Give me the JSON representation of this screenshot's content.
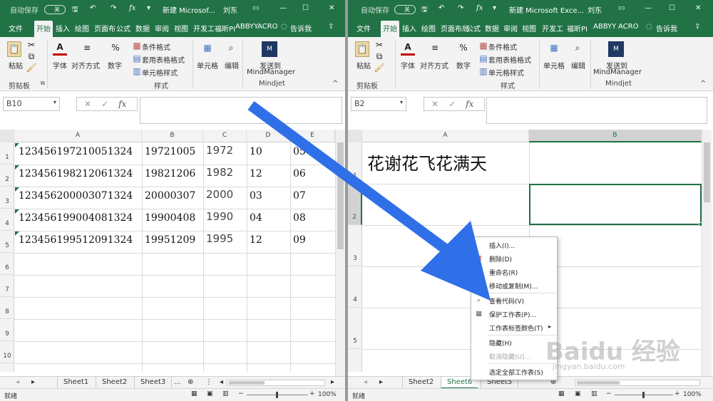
{
  "left": {
    "titlebar": {
      "autosave": "自动保存",
      "toggle": "关",
      "title": "新建 Microsof...",
      "user": "刘东"
    },
    "tabs": [
      "文件",
      "开始",
      "插入",
      "绘图",
      "页面布",
      "公式",
      "数据",
      "审阅",
      "视图",
      "开发工",
      "福昕PI",
      "ABBYY",
      "ACRO"
    ],
    "tell_me": "告诉我",
    "ribbon": {
      "paste": "粘贴",
      "clipboard": "剪贴板",
      "font": "字体",
      "align": "对齐方式",
      "number": "数字",
      "cond_format": "条件格式",
      "table_format": "套用表格格式",
      "cell_style": "单元格样式",
      "styles": "样式",
      "cells": "单元格",
      "edit": "编辑",
      "send_to": "发送到",
      "mindmanager": "MindManager",
      "mindjet": "Mindjet"
    },
    "namebox": "B10",
    "fx": "fx",
    "columns": [
      "A",
      "B",
      "C",
      "D",
      "E"
    ],
    "rows": [
      "1",
      "2",
      "3",
      "4",
      "5",
      "6",
      "7",
      "8",
      "9",
      "10"
    ],
    "data": [
      [
        "123456197210051324",
        "19721005",
        "1972",
        "10",
        "05"
      ],
      [
        "123456198212061324",
        "19821206",
        "1982",
        "12",
        "06"
      ],
      [
        "123456200003071324",
        "20000307",
        "2000",
        "03",
        "07"
      ],
      [
        "123456199004081324",
        "19900408",
        "1990",
        "04",
        "08"
      ],
      [
        "123456199512091324",
        "19951209",
        "1995",
        "12",
        "09"
      ]
    ],
    "sheets": [
      "Sheet1",
      "Sheet2",
      "Sheet3"
    ],
    "more": "...",
    "status": "就绪",
    "zoom": "100%"
  },
  "right": {
    "titlebar": {
      "autosave": "自动保存",
      "toggle": "关",
      "title": "新建 Microsoft Exce...",
      "user": "刘东"
    },
    "tabs": [
      "文件",
      "开始",
      "插入",
      "绘图",
      "页面布局",
      "公式",
      "数据",
      "审阅",
      "视图",
      "开发工",
      "福昕PI",
      "ABBYY",
      "ACRO"
    ],
    "tell_me": "告诉我",
    "ribbon": {
      "paste": "粘贴",
      "clipboard": "剪贴板",
      "font": "字体",
      "align": "对齐方式",
      "number": "数字",
      "cond_format": "条件格式",
      "table_format": "套用表格格式",
      "cell_style": "单元格样式",
      "styles": "样式",
      "cells": "单元格",
      "edit": "编辑",
      "send_to": "发送到",
      "mindmanager": "MindManager",
      "mindjet": "Mindjet"
    },
    "namebox": "B2",
    "fx": "fx",
    "columns": [
      "A",
      "B"
    ],
    "rows": [
      "1",
      "2",
      "3",
      "4",
      "5"
    ],
    "a1": "花谢花飞花满天",
    "sheets": [
      "Sheet2",
      "Sheet6",
      "Sheet5"
    ],
    "status": "就绪",
    "zoom": "100%"
  },
  "context_menu": [
    {
      "label": "插入(I)...",
      "enabled": true
    },
    {
      "label": "删除(D)",
      "enabled": true,
      "icon": "delete-icon"
    },
    {
      "label": "重命名(R)",
      "enabled": true
    },
    {
      "label": "移动或复制(M)...",
      "enabled": true
    },
    {
      "label": "查看代码(V)",
      "enabled": true,
      "icon": "view-code-icon"
    },
    {
      "label": "保护工作表(P)...",
      "enabled": true,
      "icon": "protect-icon"
    },
    {
      "label": "工作表标签颜色(T)",
      "enabled": true,
      "submenu": true
    },
    {
      "label": "隐藏(H)",
      "enabled": true
    },
    {
      "label": "取消隐藏(U)...",
      "enabled": false
    },
    {
      "label": "选定全部工作表(S)",
      "enabled": true
    }
  ],
  "watermark": {
    "brand": "Baidu 经验",
    "url": "jingyan.baidu.com"
  },
  "colors": {
    "excel_green": "#217346",
    "arrow_blue": "#2f6fe8",
    "selection": "#1e7145"
  }
}
